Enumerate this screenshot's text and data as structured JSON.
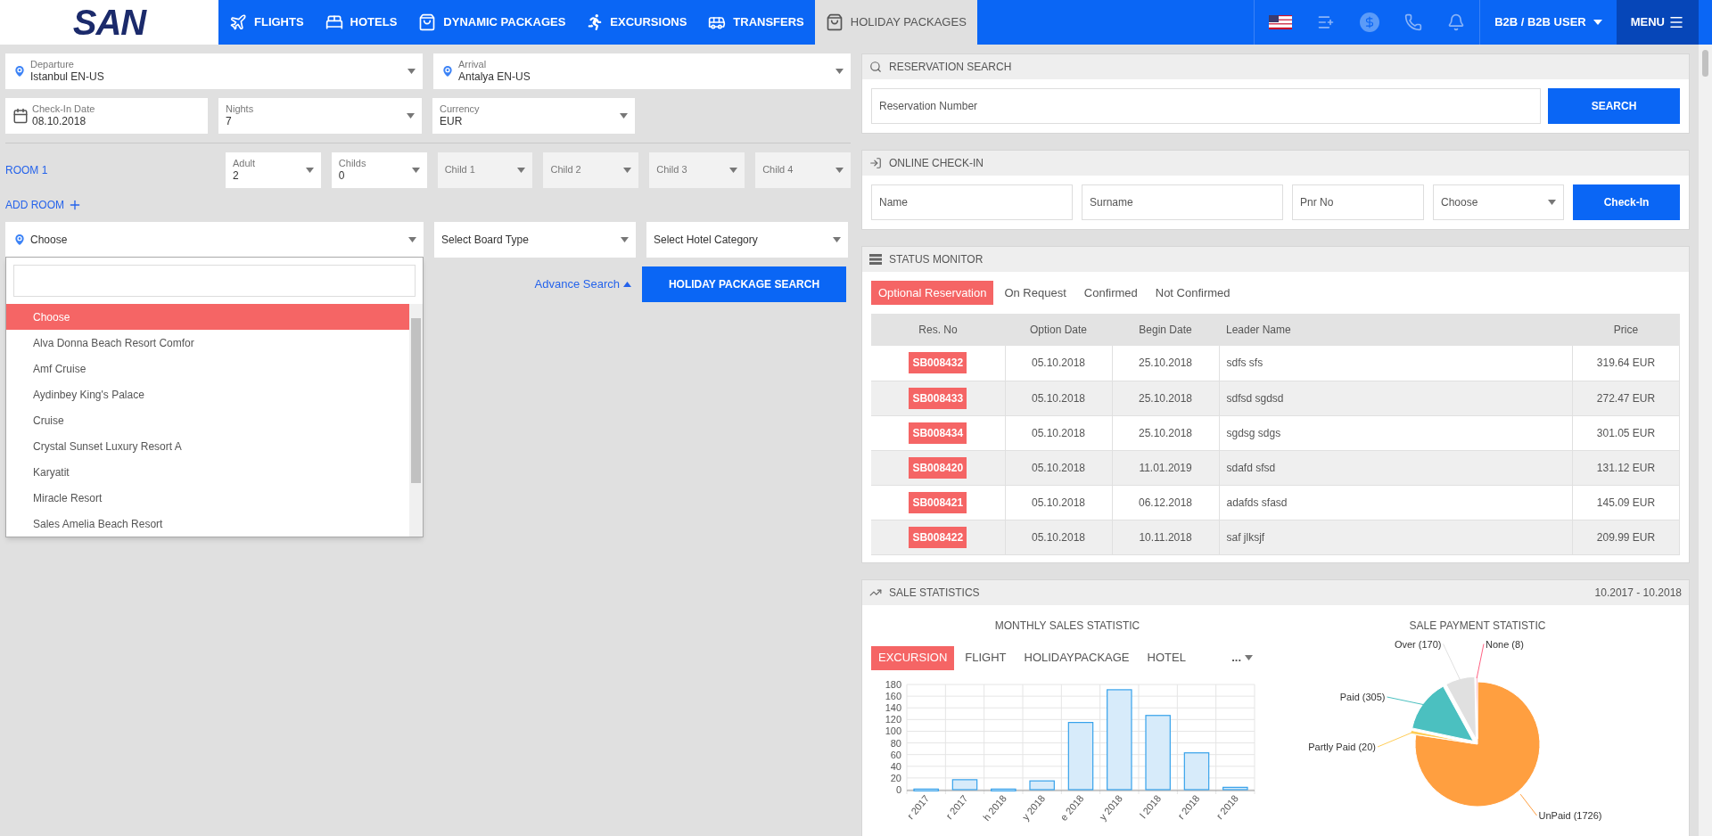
{
  "logo": {
    "text": "SAN"
  },
  "nav": {
    "items": [
      {
        "label": "FLIGHTS",
        "selected": false
      },
      {
        "label": "HOTELS",
        "selected": false
      },
      {
        "label": "DYNAMIC PACKAGES",
        "selected": false
      },
      {
        "label": "EXCURSIONS",
        "selected": false
      },
      {
        "label": "TRANSFERS",
        "selected": false
      },
      {
        "label": "HOLIDAY PACKAGES",
        "selected": true
      }
    ],
    "user": "B2B / B2B USER",
    "menu": "MENU"
  },
  "search_form": {
    "departure": {
      "label": "Departure",
      "value": "Istanbul EN-US"
    },
    "arrival": {
      "label": "Arrival",
      "value": "Antalya EN-US"
    },
    "checkin": {
      "label": "Check-In Date",
      "value": "08.10.2018"
    },
    "nights": {
      "label": "Nights",
      "value": "7"
    },
    "currency": {
      "label": "Currency",
      "value": "EUR"
    },
    "rooms": [
      {
        "label": "ROOM 1",
        "fields": [
          {
            "label": "Adult",
            "value": "2",
            "disabled": false
          },
          {
            "label": "Childs",
            "value": "0",
            "disabled": false
          },
          {
            "label": "Child 1",
            "disabled": true
          },
          {
            "label": "Child 2",
            "disabled": true
          },
          {
            "label": "Child 3",
            "disabled": true
          },
          {
            "label": "Child 4",
            "disabled": true
          }
        ]
      }
    ],
    "add_room": "ADD ROOM",
    "hotel": {
      "value": "Choose",
      "expanded": true
    },
    "board": {
      "placeholder": "Select Board Type"
    },
    "category": {
      "placeholder": "Select Hotel Category"
    },
    "hotel_options": [
      {
        "label": "Choose",
        "selected": true
      },
      {
        "label": "Alva Donna Beach Resort Comfor",
        "selected": false
      },
      {
        "label": "Amf Cruise",
        "selected": false
      },
      {
        "label": "Aydinbey King's Palace",
        "selected": false
      },
      {
        "label": "Cruise",
        "selected": false
      },
      {
        "label": "Crystal Sunset Luxury Resort A",
        "selected": false
      },
      {
        "label": "Karyatit",
        "selected": false
      },
      {
        "label": "Miracle Resort",
        "selected": false
      },
      {
        "label": "Sales Amelia Beach Resort",
        "selected": false
      }
    ],
    "advance_search": "Advance Search",
    "search_button": "HOLIDAY PACKAGE SEARCH"
  },
  "reservation_search": {
    "title": "RESERVATION SEARCH",
    "placeholder": "Reservation Number",
    "button": "SEARCH"
  },
  "online_checkin": {
    "title": "ONLINE CHECK-IN",
    "fields": [
      {
        "placeholder": "Name"
      },
      {
        "placeholder": "Surname"
      },
      {
        "placeholder": "Pnr No"
      }
    ],
    "select": "Choose",
    "button": "Check-In"
  },
  "status_monitor": {
    "title": "STATUS MONITOR",
    "tabs": [
      {
        "label": "Optional Reservation",
        "selected": true
      },
      {
        "label": "On Request",
        "selected": false
      },
      {
        "label": "Confirmed",
        "selected": false
      },
      {
        "label": "Not Confirmed",
        "selected": false
      }
    ],
    "columns": [
      "Res. No",
      "Option Date",
      "Begin Date",
      "Leader Name",
      "Price"
    ],
    "rows": [
      [
        "SB008432",
        "05.10.2018",
        "25.10.2018",
        "sdfs sfs",
        "319.64 EUR"
      ],
      [
        "SB008433",
        "05.10.2018",
        "25.10.2018",
        "sdfsd sgdsd",
        "272.47 EUR"
      ],
      [
        "SB008434",
        "05.10.2018",
        "25.10.2018",
        "sgdsg sdgs",
        "301.05 EUR"
      ],
      [
        "SB008420",
        "05.10.2018",
        "11.01.2019",
        "sdafd sfsd",
        "131.12 EUR"
      ],
      [
        "SB008421",
        "05.10.2018",
        "06.12.2018",
        "adafds sfasd",
        "145.09 EUR"
      ],
      [
        "SB008422",
        "05.10.2018",
        "10.11.2018",
        "saf jlksjf",
        "209.99 EUR"
      ]
    ]
  },
  "sale_statistics": {
    "title": "SALE STATISTICS",
    "period": "10.2017 - 10.2018",
    "monthly": {
      "title": "MONTHLY SALES STATISTIC",
      "tabs": [
        {
          "label": "EXCURSION",
          "selected": true
        },
        {
          "label": "FLIGHT",
          "selected": false
        },
        {
          "label": "HOLIDAYPACKAGE",
          "selected": false
        },
        {
          "label": "HOTEL",
          "selected": false
        }
      ],
      "more": "...",
      "chart_data": {
        "type": "bar",
        "categories": [
          "r 2017",
          "r 2017",
          "h 2018",
          "y 2018",
          "e 2018",
          "y 2018",
          "l 2018",
          "r 2018",
          "r 2018"
        ],
        "values": [
          1,
          17,
          1,
          15,
          115,
          171,
          127,
          63,
          4
        ],
        "grid": true,
        "ylim": [
          0,
          180
        ],
        "yticks": [
          0,
          20,
          40,
          60,
          80,
          100,
          120,
          140,
          160,
          180
        ]
      }
    },
    "payment": {
      "title": "SALE PAYMENT STATISTIC",
      "chart_data": {
        "type": "pie",
        "categories": [
          "UnPaid (1726)",
          "Partly Paid (20)",
          "Paid (305)",
          "Over (170)",
          "None (8)"
        ],
        "values": [
          1726,
          20,
          305,
          170,
          8
        ],
        "colors": [
          "#ff9f40",
          "#ffcd56",
          "#4bc0c0",
          "#e0e0e0",
          "#ff6384"
        ]
      }
    }
  }
}
